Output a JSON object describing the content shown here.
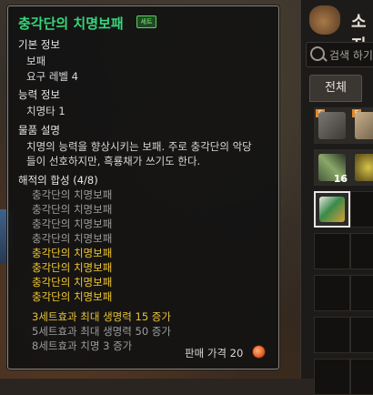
{
  "inventory": {
    "title": "소지",
    "search_placeholder": "검색 하기",
    "tab_all": "전체",
    "slot_counts": {
      "slot_4": "16"
    }
  },
  "tooltip": {
    "item_name": "충각단의 치명보패",
    "badge": "세트",
    "basic_info_header": "기본 정보",
    "item_type": "보패",
    "required_level": "요구 레벨 4",
    "stats_header": "능력 정보",
    "stat_line": "치명타 1",
    "desc_header": "물품 설명",
    "desc_line1": "치명의 능력을 향상시키는 보패. 주로 충각단의 악당",
    "desc_line2": "들이 선호하지만, 흑룡채가 쓰기도 한다.",
    "set_header": "해적의 합성 (4/8)",
    "set_pieces": [
      "충각단의 치명보패",
      "충각단의 치명보패",
      "충각단의 치명보패",
      "충각단의 치명보패",
      "충각단의 치명보패",
      "충각단의 치명보패",
      "충각단의 치명보패",
      "충각단의 치명보패"
    ],
    "set_bonus_1": "3세트효과  최대 생명력 15 증가",
    "set_bonus_2": "5세트효과  최대 생명력 50 증가",
    "set_bonus_3": "8세트효과  치명 3 증가",
    "price_label": "판매 가격 20"
  },
  "colors": {
    "item_name": "#37d67a",
    "active_set": "#f0c830",
    "inactive_set": "#9c9c9c"
  }
}
